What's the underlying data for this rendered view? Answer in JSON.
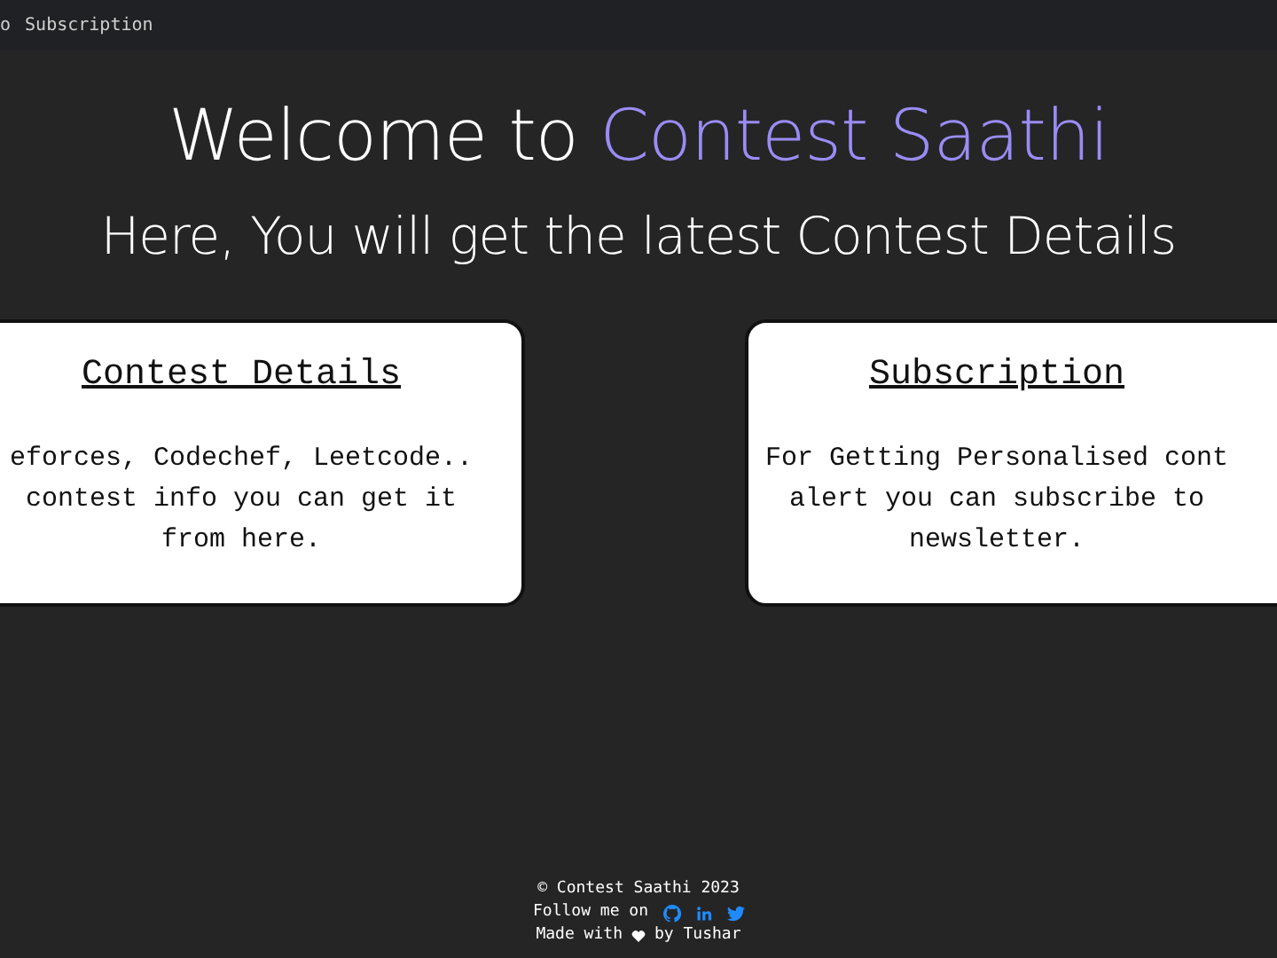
{
  "nav": {
    "items": [
      "o",
      "Subscription"
    ]
  },
  "hero": {
    "title": "Welcome to",
    "title_highlight": "Contest Saathi",
    "subtitle": "Here, You will get the latest Contest Details"
  },
  "cards": [
    {
      "title": "Contest Details",
      "lines": [
        "eforces, Codechef, Leetcode..",
        "contest info you can get it",
        "from here."
      ]
    },
    {
      "title": "Subscription",
      "lines": [
        "For Getting Personalised cont",
        "alert you can subscribe to",
        "newsletter."
      ]
    }
  ],
  "footer": {
    "copyright": "© Contest Saathi 2023",
    "follow": "Follow me on",
    "made_with": "Made with",
    "by": "by Tushar"
  }
}
